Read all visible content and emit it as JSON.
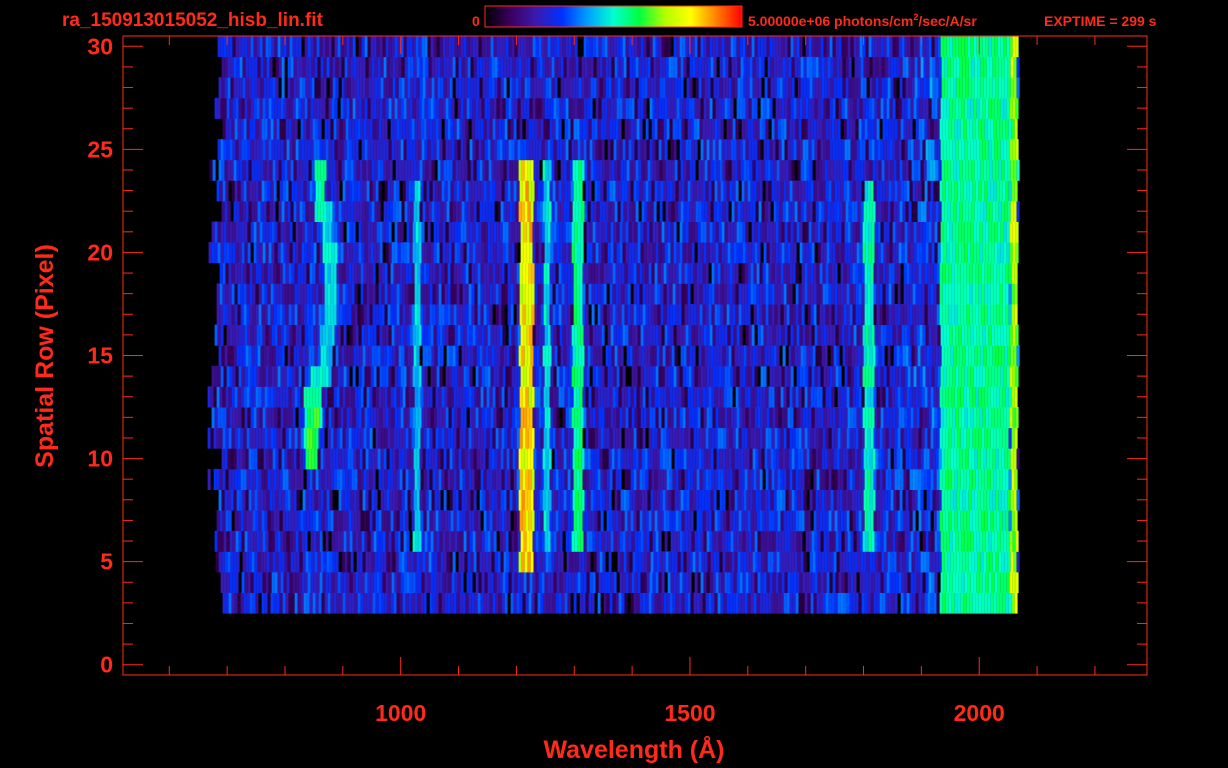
{
  "header": {
    "filename": "ra_150913015052_hisb_lin.fit",
    "colorbar_min": "0",
    "colorbar_max_value": "5.00000e+06",
    "colorbar_units_pre": "photons/cm",
    "colorbar_units_sup": "2",
    "colorbar_units_post": "/sec/A/sr",
    "exptime": "EXPTIME = 299 s"
  },
  "chart_data": {
    "type": "heatmap",
    "title": "",
    "xlabel": "Wavelength (Å)",
    "ylabel": "Spatial Row (Pixel)",
    "xlim": [
      520,
      2290
    ],
    "ylim": [
      -0.5,
      30.5
    ],
    "x_ticks": [
      1000,
      1500,
      2000
    ],
    "x_tick_labels": [
      "1000",
      "1500",
      "2000"
    ],
    "y_ticks": [
      0,
      5,
      10,
      15,
      20,
      25,
      30
    ],
    "y_tick_labels": [
      "0",
      "5",
      "10",
      "15",
      "20",
      "25",
      "30"
    ],
    "colorscale": {
      "min": 0,
      "max": 5000000,
      "colors": [
        "#000000",
        "#3a0060",
        "#3a1ab0",
        "#0030ff",
        "#00a0ff",
        "#00ffd0",
        "#00ff40",
        "#b0ff00",
        "#ffff00",
        "#ff8000",
        "#ff0000"
      ]
    },
    "background_band": {
      "x_range": [
        680,
        2065
      ],
      "rows": [
        3,
        30
      ],
      "level": 0.25
    },
    "emission_features": [
      {
        "x_center": 1215,
        "half_width": 12,
        "rows": [
          5,
          24
        ],
        "level": 0.82
      },
      {
        "x_center": 1304,
        "half_width": 10,
        "rows": [
          6,
          24
        ],
        "level": 0.55
      },
      {
        "x_center": 1250,
        "half_width": 6,
        "rows": [
          6,
          24
        ],
        "level": 0.48
      },
      {
        "x_center": 1025,
        "half_width": 6,
        "rows": [
          6,
          23
        ],
        "level": 0.45
      },
      {
        "x_center": 1807,
        "half_width": 10,
        "rows": [
          6,
          23
        ],
        "level": 0.52
      },
      {
        "x_center": 1990,
        "half_width": 60,
        "rows": [
          3,
          30
        ],
        "level": 0.55
      },
      {
        "x_center": 2058,
        "half_width": 6,
        "rows": [
          2,
          30
        ],
        "level": 0.72
      }
    ],
    "arc_feature": [
      {
        "row": 23,
        "x": 858,
        "level": 0.55
      },
      {
        "row": 21,
        "x": 870,
        "level": 0.5
      },
      {
        "row": 19,
        "x": 878,
        "level": 0.47
      },
      {
        "row": 17,
        "x": 875,
        "level": 0.47
      },
      {
        "row": 15,
        "x": 868,
        "level": 0.47
      },
      {
        "row": 13,
        "x": 852,
        "level": 0.52
      },
      {
        "row": 12,
        "x": 840,
        "level": 0.55
      },
      {
        "row": 11,
        "x": 845,
        "level": 0.62
      }
    ]
  }
}
